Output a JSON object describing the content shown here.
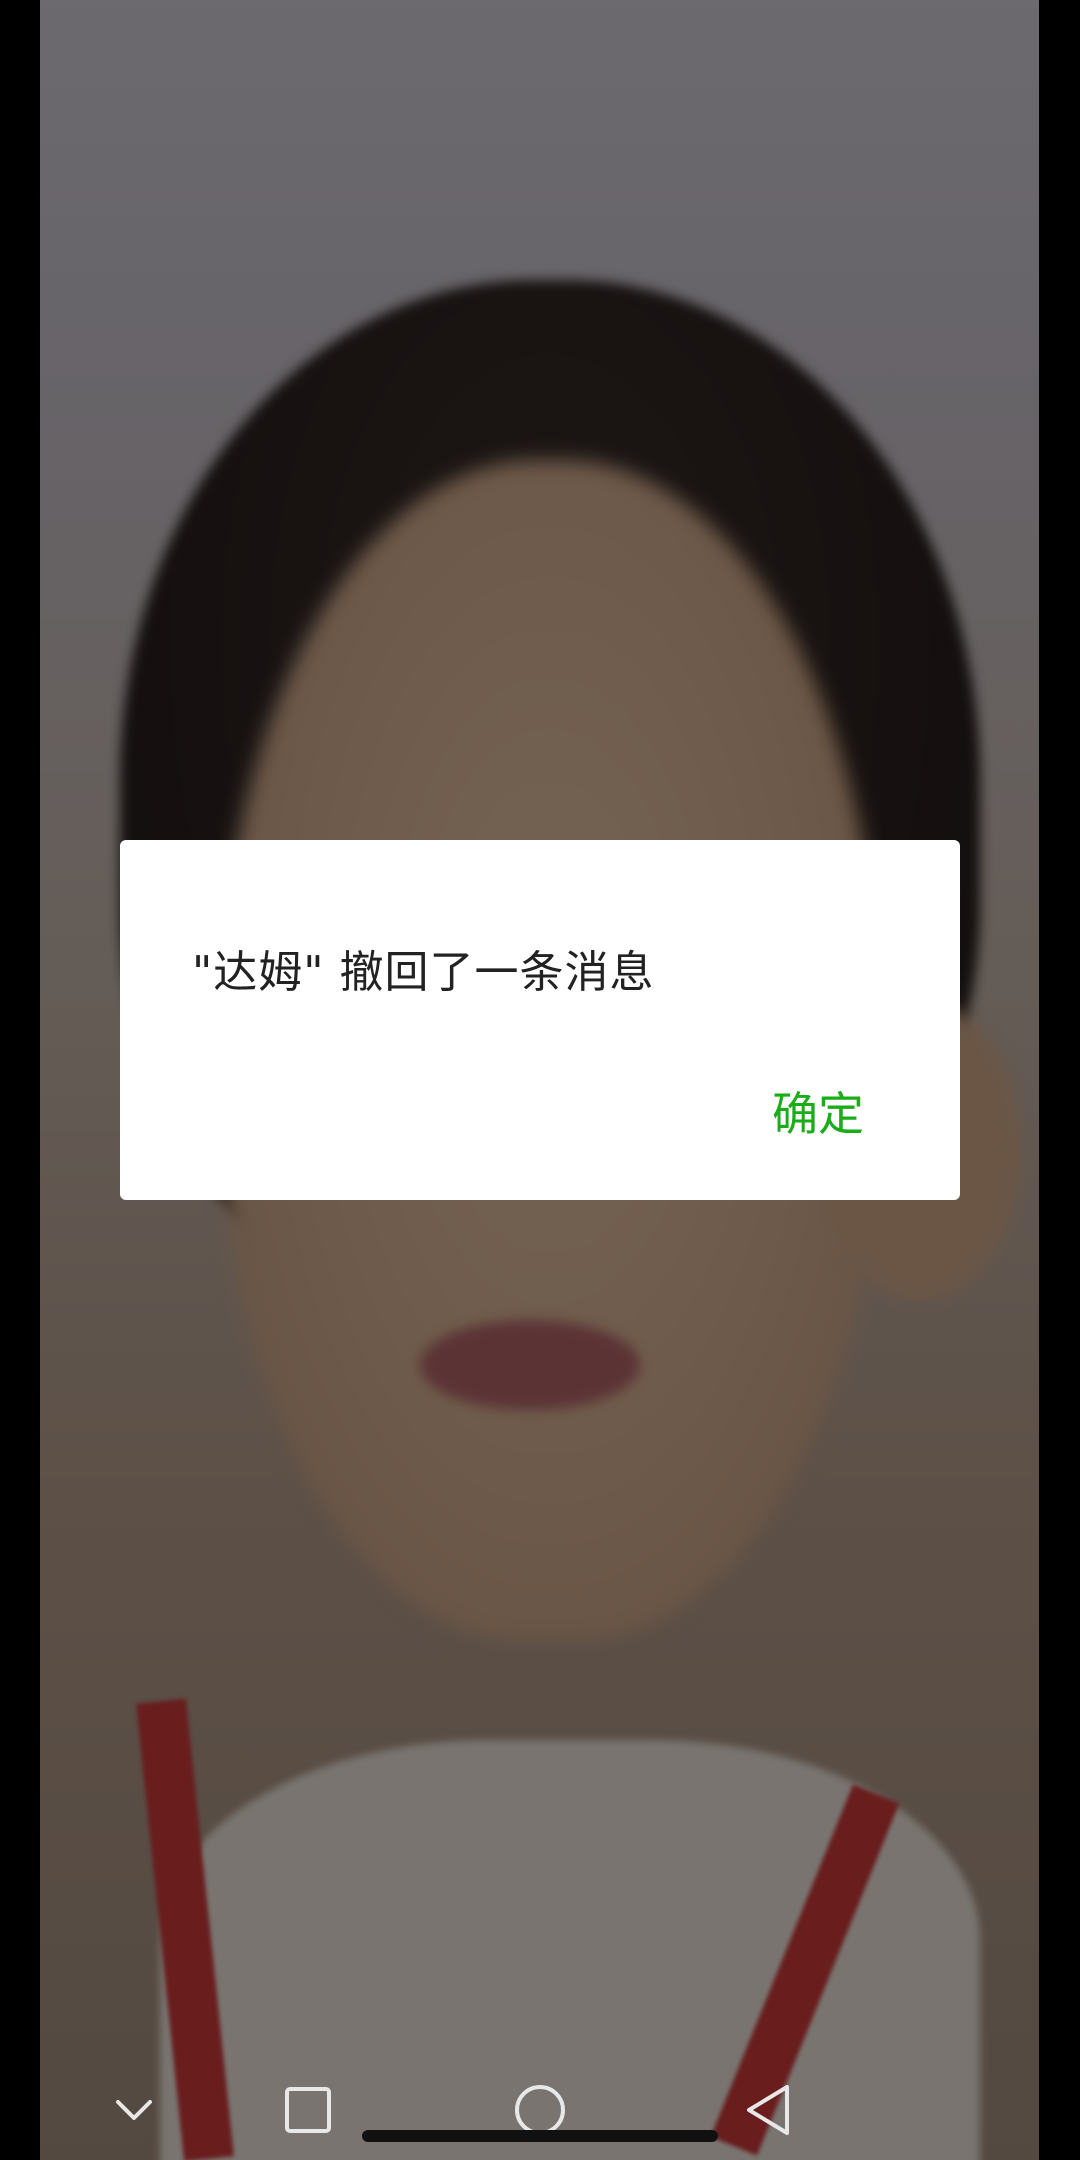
{
  "dialog": {
    "message": "\"达姆\" 撤回了一条消息",
    "confirm_label": "确定"
  },
  "colors": {
    "accent": "#1aad19",
    "dialog_background": "#ffffff",
    "scrim": "rgba(0,0,0,0.5)"
  },
  "navigation_bar": {
    "icons": [
      "chevron-down-icon",
      "recents-square-icon",
      "home-circle-icon",
      "back-triangle-icon"
    ]
  }
}
